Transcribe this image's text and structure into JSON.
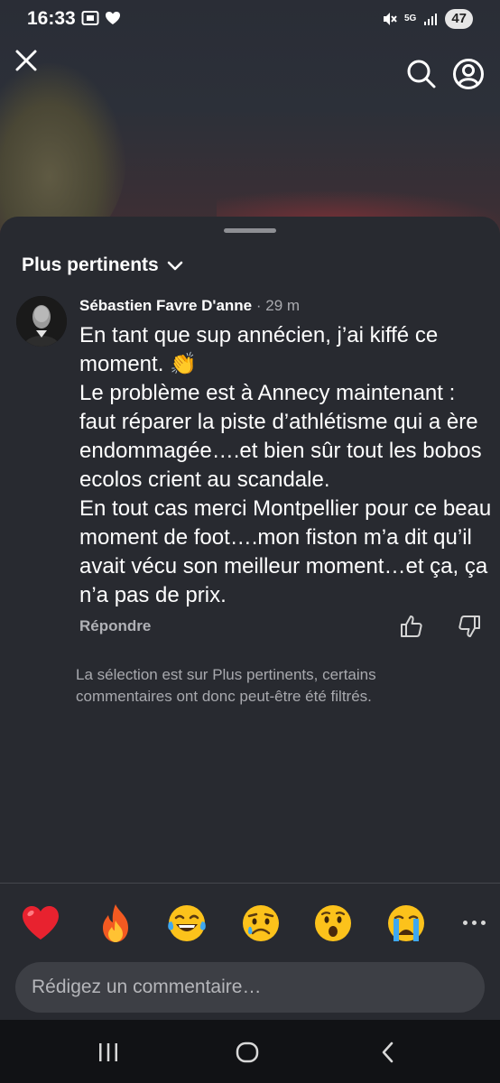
{
  "status_bar": {
    "time": "16:33",
    "network": "5G",
    "battery": "47"
  },
  "header": {
    "close_icon": "close-icon",
    "search_icon": "search-icon",
    "profile_icon": "profile-icon"
  },
  "sheet": {
    "sort_label": "Plus pertinents",
    "comment": {
      "author": "Sébastien Favre D'anne",
      "separator": "·",
      "time": "29 m",
      "text": "En tant que sup annécien, j’ai kiffé ce moment. 👏\nLe problème est à Annecy maintenant : faut réparer la piste d’athlétisme qui a ère endommagée….et bien sûr tout les bobos ecolos crient au scandale.\nEn tout cas merci Montpellier pour ce beau moment de foot….mon fiston m’a dit qu’il avait vécu son meilleur moment…et ça, ça n’a pas de prix.",
      "reply_label": "Répondre"
    },
    "filter_note": "La sélection est sur Plus pertinents, certains commentaires ont donc peut-être été filtrés."
  },
  "reactions": {
    "items": [
      "❤️",
      "🔥",
      "😂",
      "😥",
      "😮",
      "😭"
    ]
  },
  "composer": {
    "placeholder": "Rédigez un commentaire…"
  }
}
